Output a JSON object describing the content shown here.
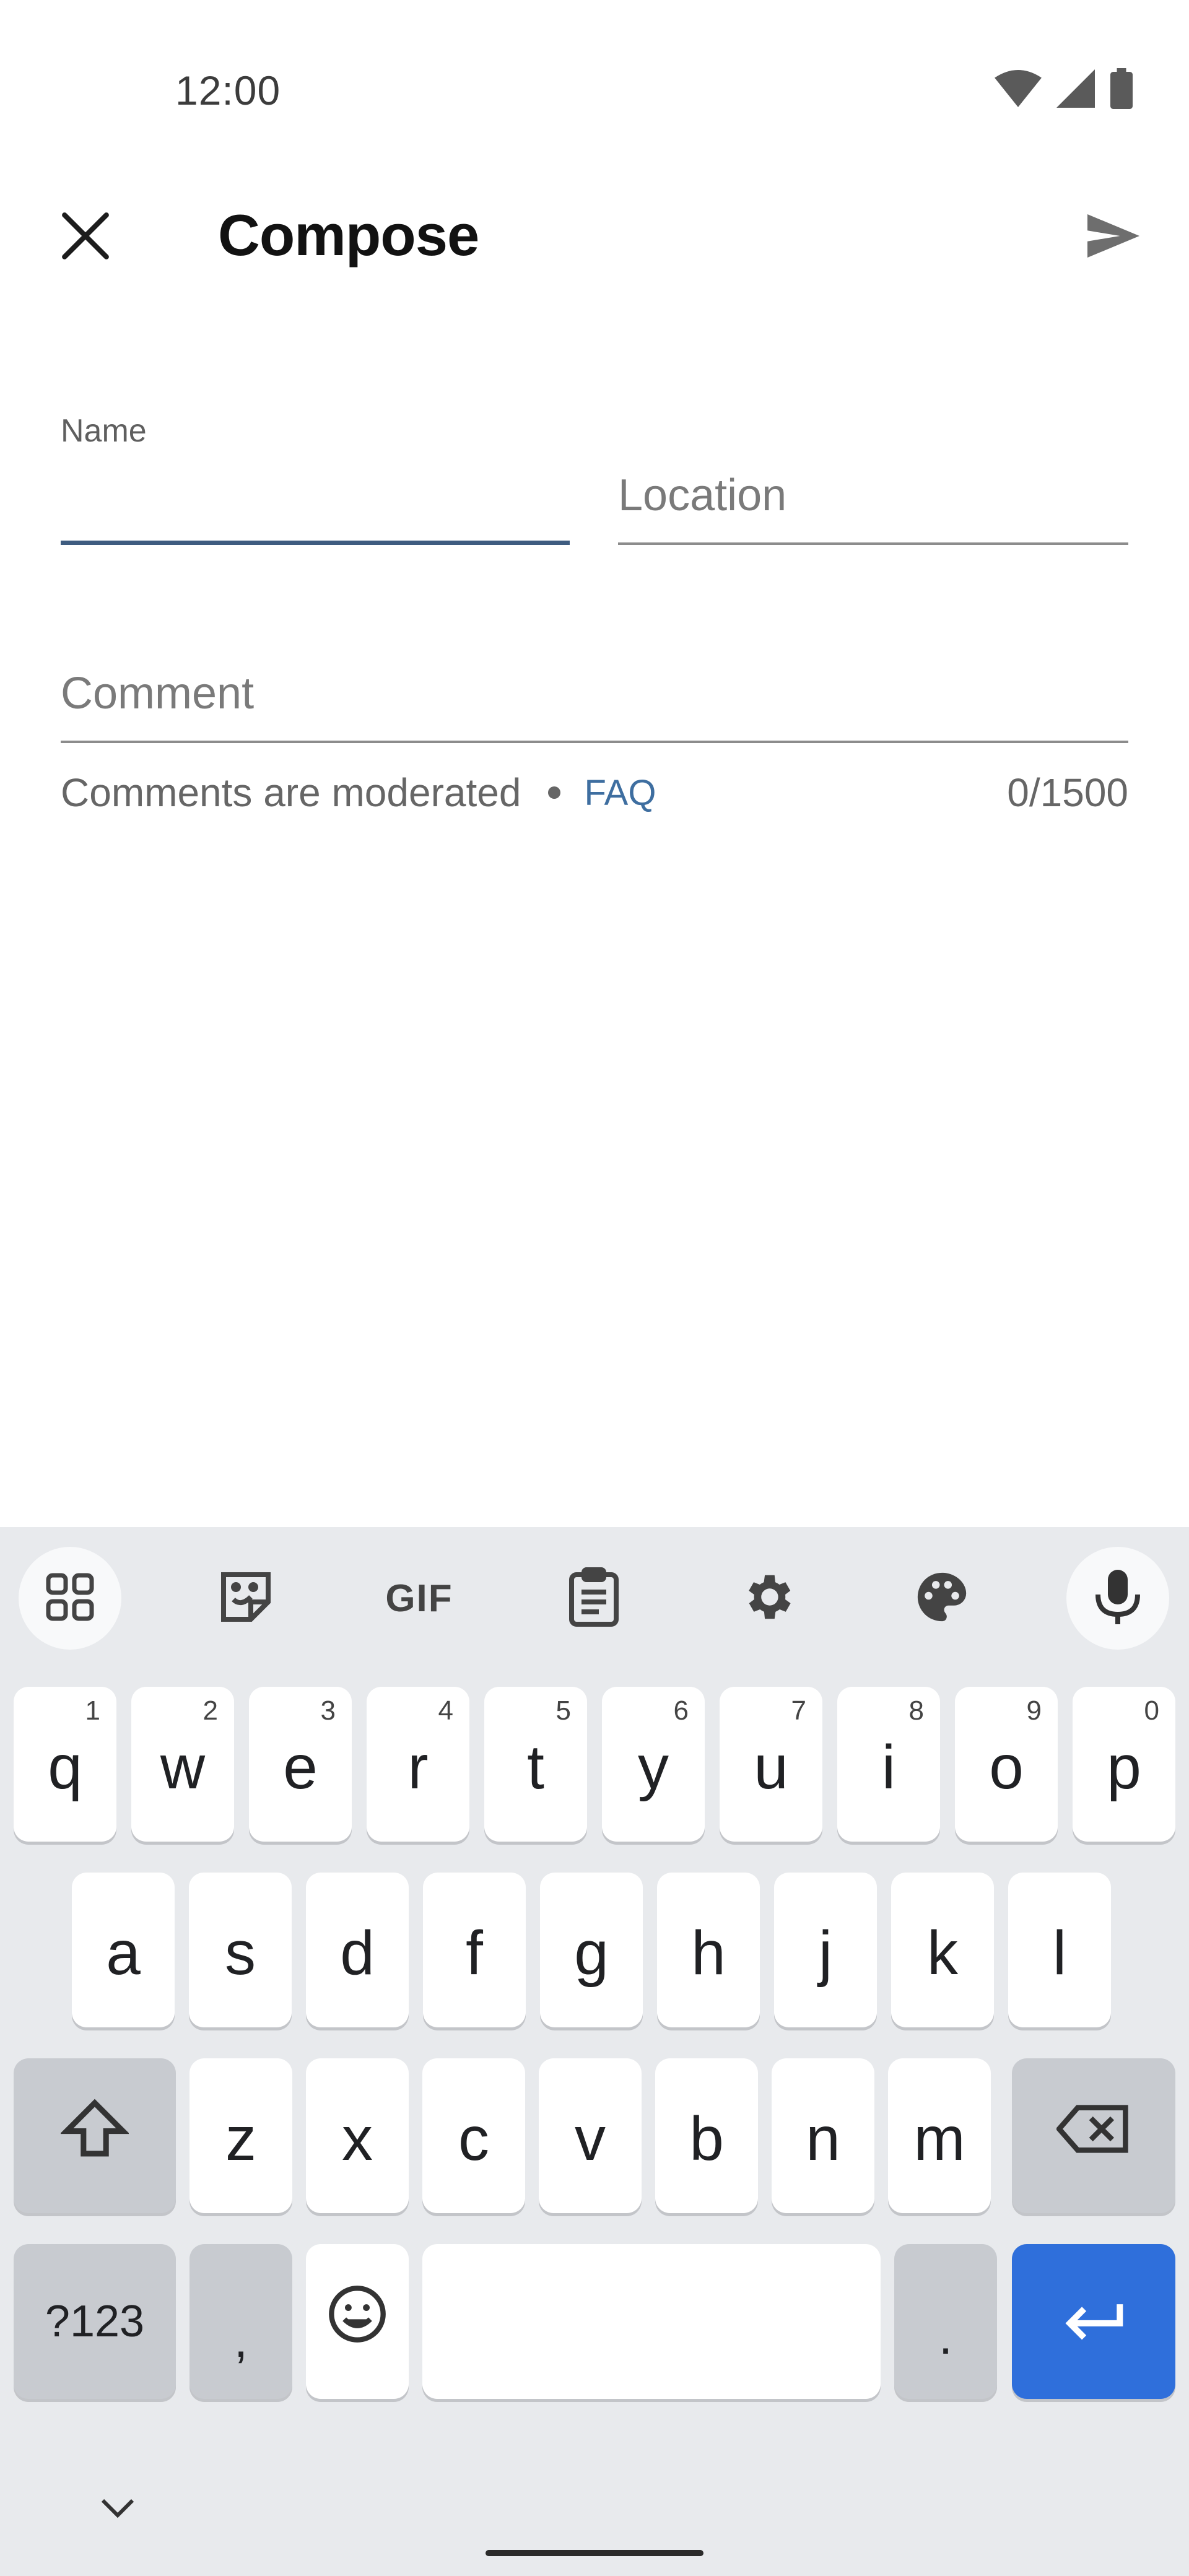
{
  "status_bar": {
    "time": "12:00",
    "icons": [
      "wifi-icon",
      "signal-icon",
      "battery-icon"
    ]
  },
  "app_bar": {
    "title": "Compose",
    "close_icon": "close-icon",
    "send_icon": "send-icon"
  },
  "form": {
    "name": {
      "label": "Name",
      "value": ""
    },
    "location": {
      "placeholder": "Location",
      "value": ""
    },
    "comment": {
      "placeholder": "Comment",
      "value": ""
    },
    "helper_text": "Comments are moderated",
    "faq_link": "FAQ",
    "counter": "0/1500"
  },
  "colors": {
    "active_underline": "#3e5c80",
    "link": "#3e6ea0",
    "enter_key": "#2f6fdb",
    "keyboard_bg": "#e8eaed"
  },
  "keyboard": {
    "toolbar": [
      "apps-grid-icon",
      "sticker-icon",
      "gif-icon",
      "clipboard-icon",
      "settings-gear-icon",
      "palette-icon",
      "microphone-icon"
    ],
    "gif_label": "GIF",
    "row1": [
      {
        "k": "q",
        "h": "1"
      },
      {
        "k": "w",
        "h": "2"
      },
      {
        "k": "e",
        "h": "3"
      },
      {
        "k": "r",
        "h": "4"
      },
      {
        "k": "t",
        "h": "5"
      },
      {
        "k": "y",
        "h": "6"
      },
      {
        "k": "u",
        "h": "7"
      },
      {
        "k": "i",
        "h": "8"
      },
      {
        "k": "o",
        "h": "9"
      },
      {
        "k": "p",
        "h": "0"
      }
    ],
    "row2": [
      "a",
      "s",
      "d",
      "f",
      "g",
      "h",
      "j",
      "k",
      "l"
    ],
    "row3": [
      "z",
      "x",
      "c",
      "v",
      "b",
      "n",
      "m"
    ],
    "symbols_key": "?123",
    "comma_key": ",",
    "period_key": "."
  }
}
